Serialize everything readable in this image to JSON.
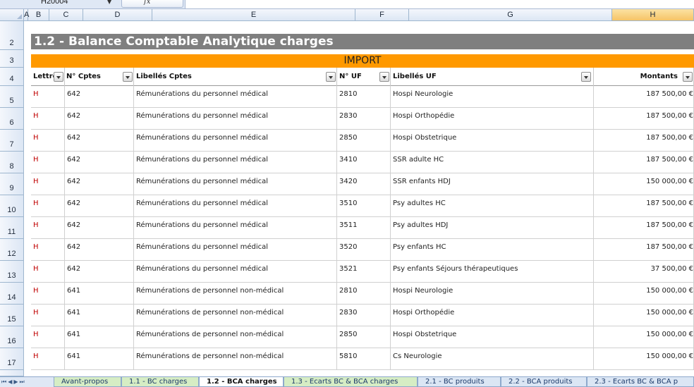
{
  "formula_bar": {
    "name_box": "H20004",
    "fx": "fx"
  },
  "columns": [
    "A",
    "B",
    "C",
    "D",
    "E",
    "F",
    "G",
    "H"
  ],
  "rows": [
    "2",
    "3",
    "4",
    "5",
    "6",
    "7",
    "8",
    "9",
    "10",
    "11",
    "12",
    "13",
    "14",
    "15",
    "16",
    "17"
  ],
  "sheet": {
    "title": "1.2 - Balance Comptable Analytique charges",
    "band": "IMPORT",
    "headers": {
      "lettre": "Lettre",
      "num_cptes": "N° Cptes",
      "libelles_cptes": "Libellés Cptes",
      "num_uf": "N° UF",
      "libelles_uf": "Libellés UF",
      "montants": "Montants"
    },
    "data": [
      {
        "lettre": "H",
        "cpte": "642",
        "lib_cpte": "Rémunérations du personnel médical",
        "uf": "2810",
        "lib_uf": "Hospi Neurologie",
        "montant": "187 500,00 €"
      },
      {
        "lettre": "H",
        "cpte": "642",
        "lib_cpte": "Rémunérations du personnel médical",
        "uf": "2830",
        "lib_uf": "Hospi Orthopédie",
        "montant": "187 500,00 €"
      },
      {
        "lettre": "H",
        "cpte": "642",
        "lib_cpte": "Rémunérations du personnel médical",
        "uf": "2850",
        "lib_uf": "Hospi Obstetrique",
        "montant": "187 500,00 €"
      },
      {
        "lettre": "H",
        "cpte": "642",
        "lib_cpte": "Rémunérations du personnel médical",
        "uf": "3410",
        "lib_uf": "SSR adulte HC",
        "montant": "187 500,00 €"
      },
      {
        "lettre": "H",
        "cpte": "642",
        "lib_cpte": "Rémunérations du personnel médical",
        "uf": "3420",
        "lib_uf": "SSR enfants HDJ",
        "montant": "150 000,00 €"
      },
      {
        "lettre": "H",
        "cpte": "642",
        "lib_cpte": "Rémunérations du personnel médical",
        "uf": "3510",
        "lib_uf": "Psy adultes HC",
        "montant": "187 500,00 €"
      },
      {
        "lettre": "H",
        "cpte": "642",
        "lib_cpte": "Rémunérations du personnel médical",
        "uf": "3511",
        "lib_uf": "Psy adultes HDJ",
        "montant": "187 500,00 €"
      },
      {
        "lettre": "H",
        "cpte": "642",
        "lib_cpte": "Rémunérations du personnel médical",
        "uf": "3520",
        "lib_uf": "Psy enfants HC",
        "montant": "187 500,00 €"
      },
      {
        "lettre": "H",
        "cpte": "642",
        "lib_cpte": "Rémunérations du personnel médical",
        "uf": "3521",
        "lib_uf": "Psy enfants Séjours thérapeutiques",
        "montant": "37 500,00 €"
      },
      {
        "lettre": "H",
        "cpte": "641",
        "lib_cpte": "Rémunérations de personnel non-médical",
        "uf": "2810",
        "lib_uf": "Hospi Neurologie",
        "montant": "150 000,00 €"
      },
      {
        "lettre": "H",
        "cpte": "641",
        "lib_cpte": "Rémunérations de personnel non-médical",
        "uf": "2830",
        "lib_uf": "Hospi Orthopédie",
        "montant": "150 000,00 €"
      },
      {
        "lettre": "H",
        "cpte": "641",
        "lib_cpte": "Rémunérations de personnel non-médical",
        "uf": "2850",
        "lib_uf": "Hospi Obstetrique",
        "montant": "150 000,00 €"
      },
      {
        "lettre": "H",
        "cpte": "641",
        "lib_cpte": "Rémunérations de personnel non-médical",
        "uf": "5810",
        "lib_uf": "Cs Neurologie",
        "montant": "150 000,00 €"
      }
    ]
  },
  "tabs": [
    {
      "label": "Avant-propos",
      "kind": "green"
    },
    {
      "label": "1.1 - BC charges",
      "kind": "green"
    },
    {
      "label": "1.2 - BCA charges",
      "kind": "active"
    },
    {
      "label": "1.3 - Ecarts BC & BCA charges",
      "kind": "green"
    },
    {
      "label": "2.1 - BC produits",
      "kind": "blue"
    },
    {
      "label": "2.2 - BCA produits",
      "kind": "blue"
    },
    {
      "label": "2.3 - Ecarts BC & BCA p",
      "kind": "blue"
    }
  ],
  "colors": {
    "title_bg": "#7f7f7f",
    "import_bg": "#ff9900",
    "letter": "#c00000"
  }
}
